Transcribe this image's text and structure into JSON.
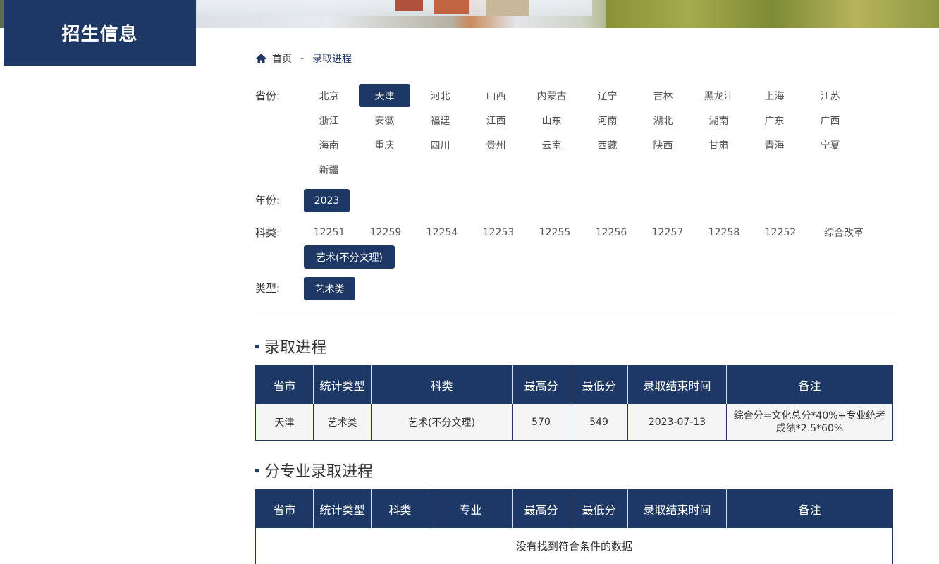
{
  "side": {
    "title": "招生信息"
  },
  "breadcrumb": {
    "home": "首页",
    "separator": "-",
    "current": "录取进程"
  },
  "filters": {
    "province_label": "省份:",
    "provinces": [
      "北京",
      "天津",
      "河北",
      "山西",
      "内蒙古",
      "辽宁",
      "吉林",
      "黑龙江",
      "上海",
      "江苏",
      "浙江",
      "安徽",
      "福建",
      "江西",
      "山东",
      "河南",
      "湖北",
      "湖南",
      "广东",
      "广西",
      "海南",
      "重庆",
      "四川",
      "贵州",
      "云南",
      "西藏",
      "陕西",
      "甘肃",
      "青海",
      "宁夏",
      "新疆"
    ],
    "province_selected": "天津",
    "year_label": "年份:",
    "years": [
      "2023"
    ],
    "year_selected": "2023",
    "subject_label": "科类:",
    "subjects": [
      "12251",
      "12259",
      "12254",
      "12253",
      "12255",
      "12256",
      "12257",
      "12258",
      "12252",
      "综合改革",
      "艺术(不分文理)"
    ],
    "subject_selected": "艺术(不分文理)",
    "type_label": "类型:",
    "types": [
      "艺术类"
    ],
    "type_selected": "艺术类"
  },
  "section1": {
    "title": "录取进程",
    "headers": [
      "省市",
      "统计类型",
      "科类",
      "最高分",
      "最低分",
      "录取结束时间",
      "备注"
    ],
    "rows": [
      [
        "天津",
        "艺术类",
        "艺术(不分文理)",
        "570",
        "549",
        "2023-07-13",
        "综合分=文化总分*40%+专业统考成绩*2.5*60%"
      ]
    ]
  },
  "section2": {
    "title": "分专业录取进程",
    "headers": [
      "省市",
      "统计类型",
      "科类",
      "专业",
      "最高分",
      "最低分",
      "录取结束时间",
      "备注"
    ],
    "empty_text": "没有找到符合条件的数据"
  },
  "colors": {
    "primary": "#1e3865"
  }
}
